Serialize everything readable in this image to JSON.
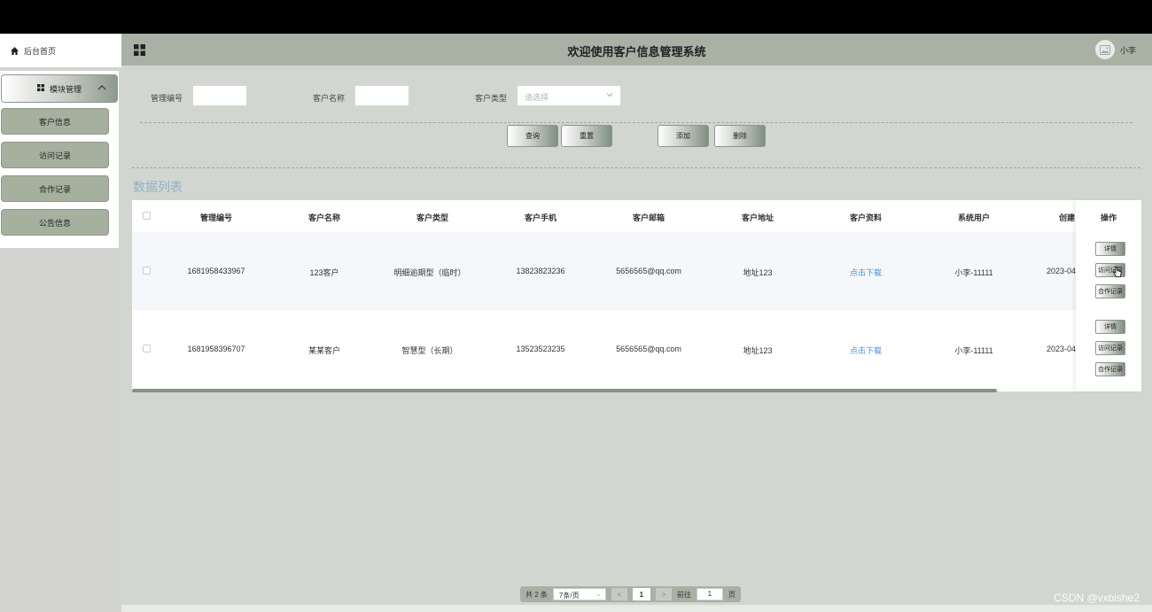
{
  "sidebar": {
    "home_label": "后台首页",
    "module_label": "模块管理",
    "items": [
      {
        "label": "客户信息"
      },
      {
        "label": "访问记录"
      },
      {
        "label": "合作记录"
      },
      {
        "label": "公告信息"
      }
    ]
  },
  "header": {
    "title": "欢迎使用客户信息管理系统",
    "username": "小李"
  },
  "search": {
    "field1_label": "管理编号",
    "field2_label": "客户名称",
    "field3_label": "客户类型",
    "field3_placeholder": "请选择"
  },
  "actions": {
    "query": "查询",
    "reset": "重置",
    "add": "添加",
    "delete": "删除"
  },
  "list": {
    "title": "数据列表",
    "columns": [
      "管理编号",
      "客户名称",
      "客户类型",
      "客户手机",
      "客户邮箱",
      "客户地址",
      "客户资料",
      "系统用户",
      "创建"
    ],
    "ops_header": "操作",
    "rows": [
      {
        "id": "1681958433967",
        "name": "123客户",
        "type": "明细逾期型（临时）",
        "phone": "13823823236",
        "email": "5656565@qq.com",
        "address": "地址123",
        "file": "点击下载",
        "user": "小李-11111",
        "created": "2023-04-"
      },
      {
        "id": "1681958396707",
        "name": "某某客户",
        "type": "智慧型（长期）",
        "phone": "13523523235",
        "email": "5656565@qq.com",
        "address": "地址123",
        "file": "点击下载",
        "user": "小李-11111",
        "created": "2023-04-"
      }
    ],
    "op_buttons": [
      "详情",
      "访问记录",
      "合作记录"
    ]
  },
  "pager": {
    "total": "共 2 条",
    "page_size": "7条/页",
    "prev": "<",
    "current": "1",
    "next": ">",
    "goto_label": "前往",
    "goto_value": "1",
    "page_suffix": "页"
  },
  "watermark": "CSDN @vxbishe2",
  "colors": {
    "header_bg": "#a8b1a3",
    "sidebar_item_bg": "#a6b09f",
    "main_bg": "#d2d6d0",
    "link": "#4a90d9",
    "list_title": "#8fb3c3"
  }
}
